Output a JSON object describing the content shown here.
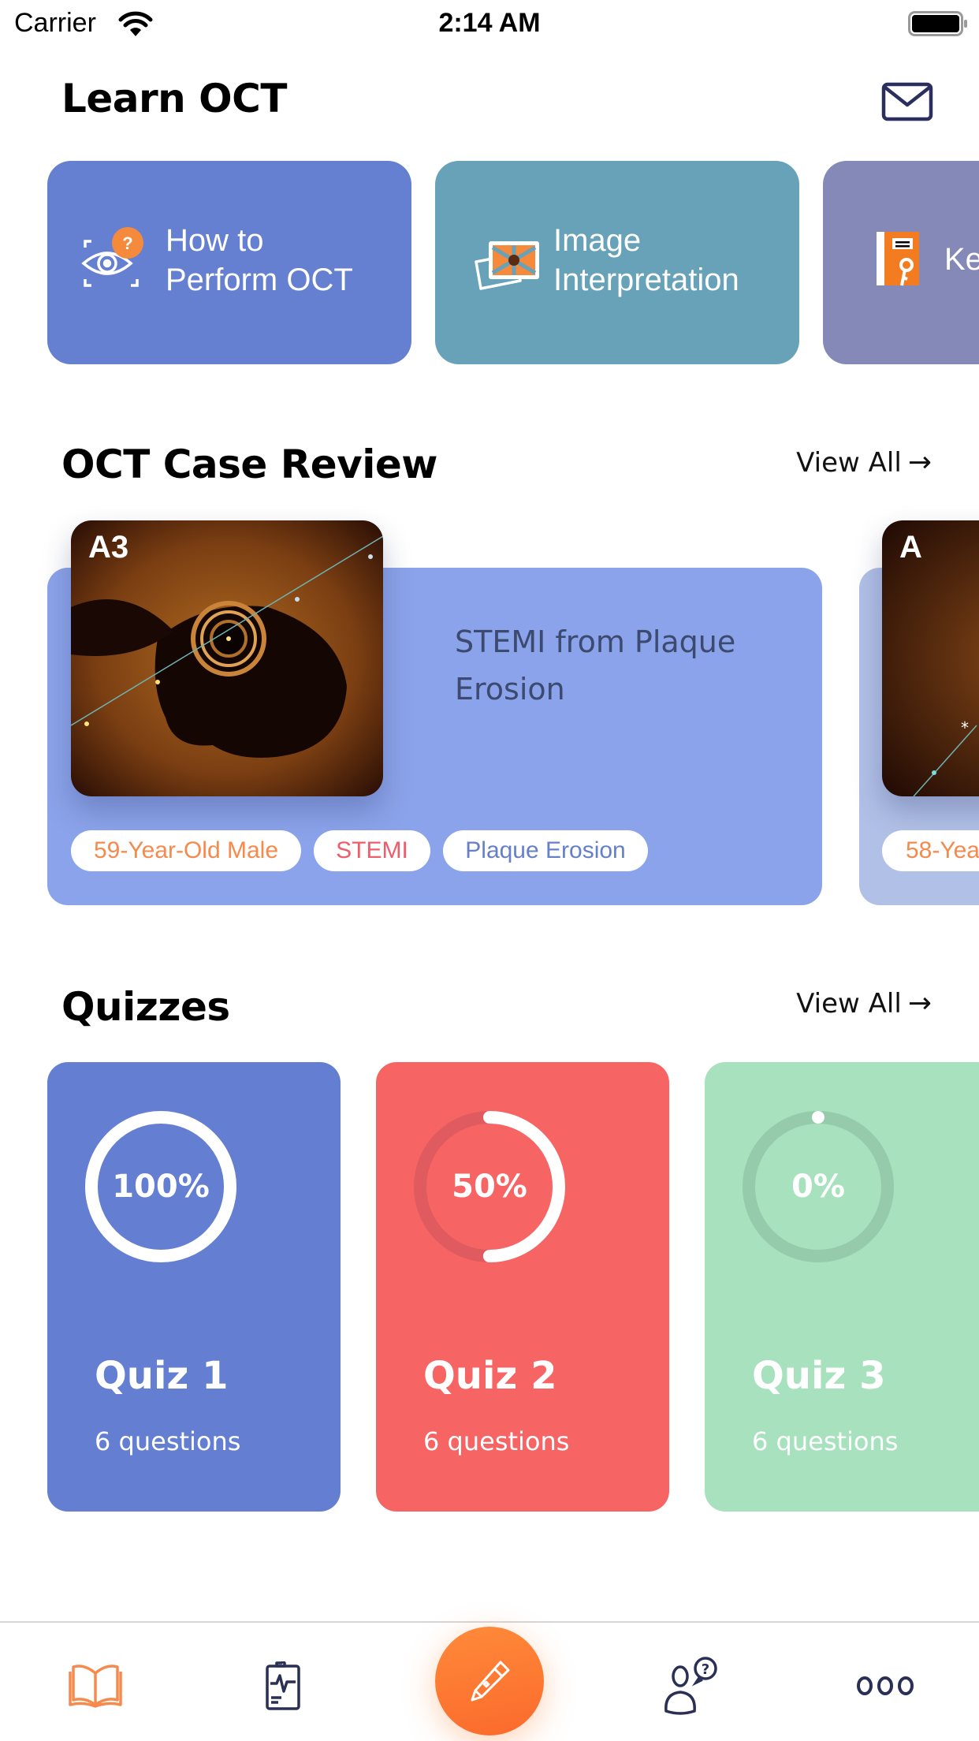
{
  "status_bar": {
    "carrier": "Carrier",
    "time": "2:14 AM"
  },
  "header": {
    "title": "Learn OCT",
    "mail_icon": "envelope-icon"
  },
  "learn": {
    "cards": [
      {
        "label_line1": "How to",
        "label_line2": "Perform OCT",
        "icon": "eye-scan-question-icon",
        "color": "#657fd1"
      },
      {
        "label_line1": "Image",
        "label_line2": "Interpretation",
        "icon": "image-photos-icon",
        "color": "#67a2b8"
      },
      {
        "label_line1": "Ke",
        "label_line2": "",
        "icon": "notebook-key-icon",
        "color": "#8489b7"
      }
    ]
  },
  "case_review": {
    "title": "OCT Case Review",
    "view_all": "View All",
    "arrow": "→",
    "cases": [
      {
        "image_label": "A3",
        "title": "STEMI from Plaque Erosion",
        "tags": [
          {
            "text": "59-Year-Old Male",
            "color": "#f58a4c"
          },
          {
            "text": "STEMI",
            "color": "#ef5c6a"
          },
          {
            "text": "Plaque Erosion",
            "color": "#6680c8"
          }
        ]
      },
      {
        "image_label": "A",
        "tags": [
          {
            "text": "58-Yea",
            "color": "#f58a4c"
          }
        ]
      }
    ]
  },
  "quizzes": {
    "title": "Quizzes",
    "view_all": "View All",
    "arrow": "→",
    "items": [
      {
        "name": "Quiz 1",
        "questions": "6 questions",
        "percent_label": "100%",
        "progress": 1.0,
        "color": "#647ed1",
        "track": "#5a72c0"
      },
      {
        "name": "Quiz 2",
        "questions": "6 questions",
        "percent_label": "50%",
        "progress": 0.5,
        "color": "#f66464",
        "track": "#e05b5f"
      },
      {
        "name": "Quiz 3",
        "questions": "6 questions",
        "percent_label": "0%",
        "progress": 0.0,
        "color": "#a7e1bd",
        "track": "#95cbab"
      }
    ]
  },
  "tab_bar": {
    "tabs": [
      {
        "name": "learn",
        "icon": "open-book-icon",
        "active": true
      },
      {
        "name": "cases",
        "icon": "clipboard-ecg-icon",
        "active": false
      },
      {
        "name": "quiz",
        "icon": "pencil-icon",
        "active": false
      },
      {
        "name": "ask-expert",
        "icon": "person-question-icon",
        "active": false
      },
      {
        "name": "more",
        "icon": "more-dots-icon",
        "active": false
      }
    ],
    "accent": "#f58a4c",
    "inactive": "#2a2f55"
  }
}
